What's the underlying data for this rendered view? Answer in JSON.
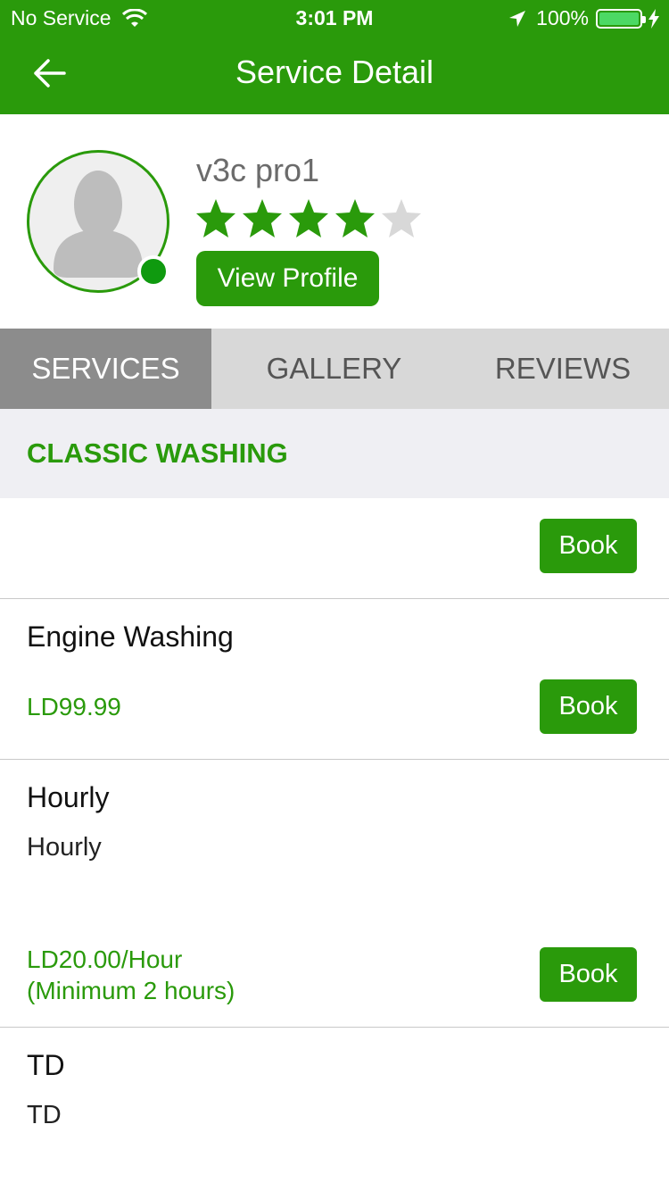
{
  "status_bar": {
    "carrier": "No Service",
    "time": "3:01 PM",
    "battery": "100%"
  },
  "header": {
    "title": "Service Detail"
  },
  "profile": {
    "name": "v3c pro1",
    "rating": 4,
    "rating_max": 5,
    "view_profile_label": "View Profile"
  },
  "tabs": [
    {
      "label": "SERVICES",
      "active": true
    },
    {
      "label": "GALLERY",
      "active": false
    },
    {
      "label": "REVIEWS",
      "active": false
    }
  ],
  "section": {
    "title": "CLASSIC WASHING"
  },
  "services": [
    {
      "title": "",
      "description": "",
      "price": "",
      "book_label": "Book"
    },
    {
      "title": "Engine Washing",
      "description": "",
      "price": "LD99.99",
      "book_label": "Book"
    },
    {
      "title": "Hourly",
      "description": "Hourly",
      "price": "LD20.00/Hour",
      "price_note": "(Minimum 2 hours)",
      "book_label": "Book"
    },
    {
      "title": "TD",
      "description": "TD"
    }
  ],
  "colors": {
    "brand_green": "#2a9a0b",
    "online_dot": "#0f9a0f",
    "star_empty": "#d8d8d8"
  }
}
